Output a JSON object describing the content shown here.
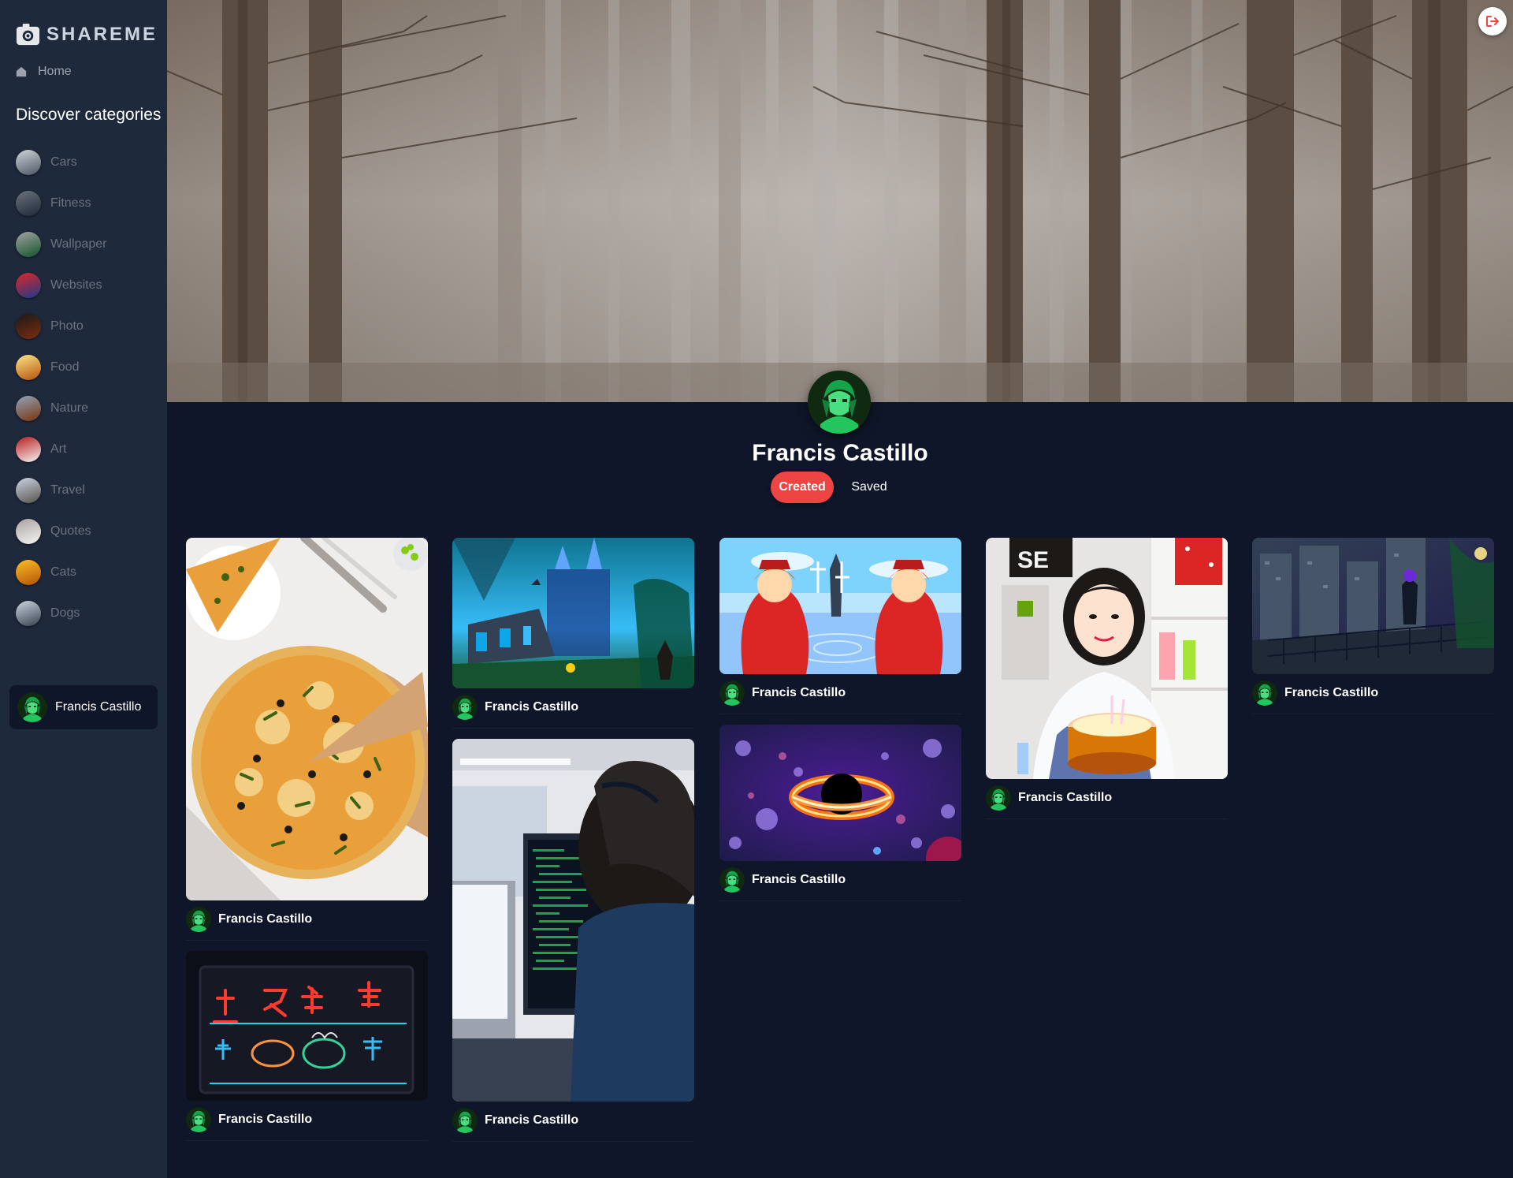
{
  "app": {
    "name": "SHAREME"
  },
  "sidebar": {
    "home_label": "Home",
    "discover_heading": "Discover categories",
    "categories": [
      {
        "label": "Cars",
        "icon": "cars-thumb",
        "colors": [
          "#4b5563",
          "#d1d5db"
        ]
      },
      {
        "label": "Fitness",
        "icon": "fitness-thumb",
        "colors": [
          "#1f2937",
          "#6b7280"
        ]
      },
      {
        "label": "Wallpaper",
        "icon": "wallpaper-thumb",
        "colors": [
          "#14532d",
          "#a3a3a3"
        ]
      },
      {
        "label": "Websites",
        "icon": "websites-thumb",
        "colors": [
          "#1e3a8a",
          "#dc2626"
        ]
      },
      {
        "label": "Photo",
        "icon": "photo-thumb",
        "colors": [
          "#7c2d12",
          "#1c1917"
        ]
      },
      {
        "label": "Food",
        "icon": "food-thumb",
        "colors": [
          "#b45309",
          "#fde68a"
        ]
      },
      {
        "label": "Nature",
        "icon": "nature-thumb",
        "colors": [
          "#78350f",
          "#94a3b8"
        ]
      },
      {
        "label": "Art",
        "icon": "art-thumb",
        "colors": [
          "#f5f5f4",
          "#b91c1c"
        ]
      },
      {
        "label": "Travel",
        "icon": "travel-thumb",
        "colors": [
          "#57534e",
          "#cbd5e1"
        ]
      },
      {
        "label": "Quotes",
        "icon": "quotes-thumb",
        "colors": [
          "#f5f5f4",
          "#a8a29e"
        ]
      },
      {
        "label": "Cats",
        "icon": "cats-thumb",
        "colors": [
          "#b45309",
          "#fbbf24"
        ]
      },
      {
        "label": "Dogs",
        "icon": "dogs-thumb",
        "colors": [
          "#374151",
          "#cbd5e1"
        ]
      }
    ],
    "profile_name": "Francis Castillo"
  },
  "profile": {
    "name": "Francis Castillo",
    "tabs": {
      "created": "Created",
      "saved": "Saved"
    },
    "active_tab": "created"
  },
  "pins": [
    {
      "author": "Francis Castillo",
      "image": "pizza-image"
    },
    {
      "author": "Francis Castillo",
      "image": "neon-sign-image"
    },
    {
      "author": "Francis Castillo",
      "image": "fantasy-castle-image"
    },
    {
      "author": "Francis Castillo",
      "image": "programmer-image"
    },
    {
      "author": "Francis Castillo",
      "image": "anime-characters-image"
    },
    {
      "author": "Francis Castillo",
      "image": "black-hole-image"
    },
    {
      "author": "Francis Castillo",
      "image": "birthday-cake-image"
    },
    {
      "author": "Francis Castillo",
      "image": "city-balcony-image"
    }
  ],
  "colors": {
    "background": "#0f1629",
    "sidebar": "#1e293b",
    "accent": "#ef4444"
  }
}
